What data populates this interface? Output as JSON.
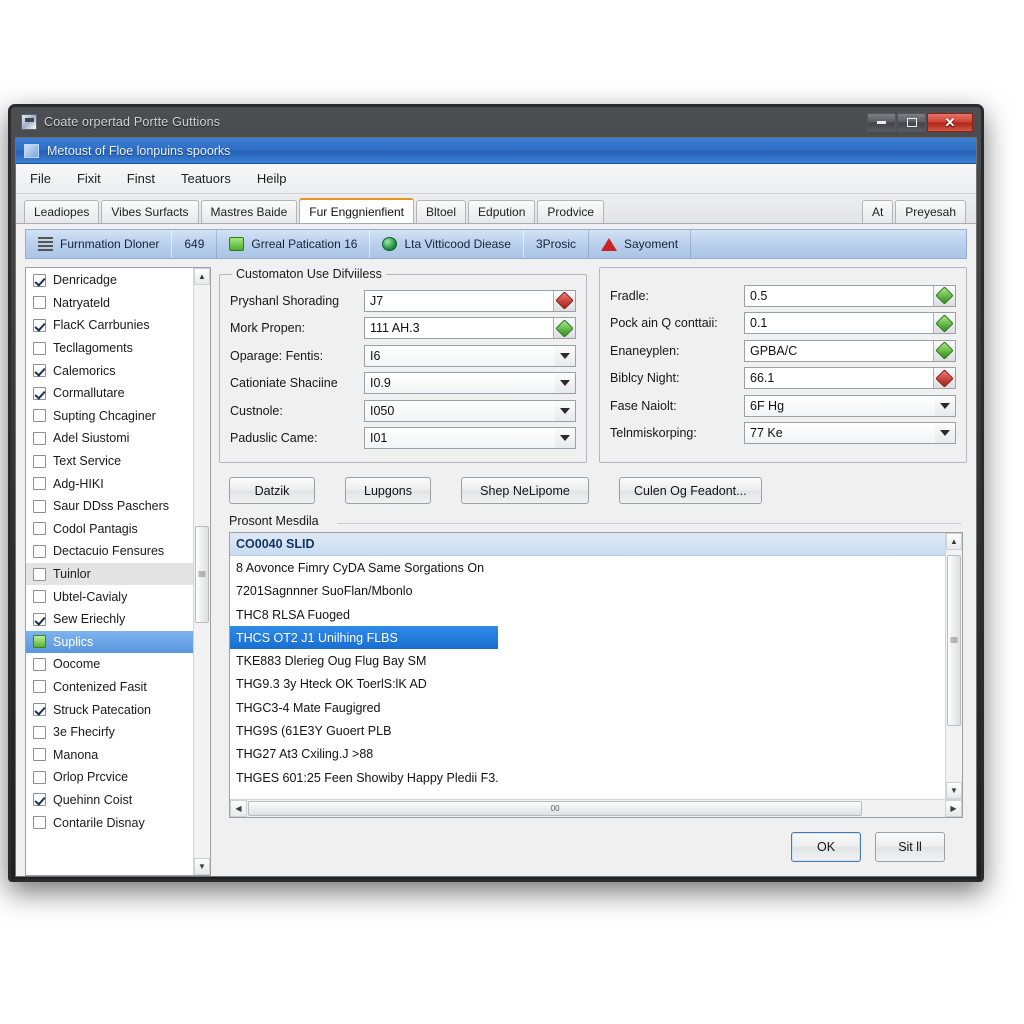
{
  "window": {
    "title": "Coate orpertad Portte Guttions",
    "icon": "app-icon",
    "controls": {
      "minimize": "minimize",
      "maximize": "maximize",
      "close": "close"
    }
  },
  "subheader": {
    "text": "Metoust of Floe lonpuins spoorks",
    "icon": "document-icon"
  },
  "menubar": {
    "items": [
      "File",
      "Fixit",
      "Finst",
      "Teatuors",
      "Heilp"
    ]
  },
  "tabs": {
    "items": [
      {
        "label": "Leadiopes",
        "active": false
      },
      {
        "label": "Vibes Surfacts",
        "active": false
      },
      {
        "label": "Mastres Baide",
        "active": false
      },
      {
        "label": "Fur Enggnienfient",
        "active": true
      },
      {
        "label": "Bltoel",
        "active": false
      },
      {
        "label": "Edpution",
        "active": false
      },
      {
        "label": "Prodvice",
        "active": false
      }
    ],
    "right_items": [
      {
        "label": "At"
      },
      {
        "label": "Preyesah"
      }
    ]
  },
  "toolstrip": {
    "cells": [
      {
        "label": "Furnmation Dloner",
        "icon": "lines-icon"
      },
      {
        "label": "649",
        "icon": "none"
      },
      {
        "label": "Grreal Patication 16",
        "icon": "green-card-icon"
      },
      {
        "label": "Lta Vitticood Diease",
        "icon": "globe-icon"
      },
      {
        "label": "3Prosic",
        "icon": "none"
      },
      {
        "label": "Sayoment",
        "icon": "warning-icon"
      }
    ]
  },
  "checklist": {
    "items": [
      {
        "label": "Denricadge",
        "checked": true,
        "state": "normal"
      },
      {
        "label": "Natryateld",
        "checked": false,
        "state": "normal"
      },
      {
        "label": "FlacK Carrbunies",
        "checked": true,
        "state": "normal"
      },
      {
        "label": "Tecllagoments",
        "checked": false,
        "state": "normal"
      },
      {
        "label": "Calemorics",
        "checked": true,
        "state": "normal"
      },
      {
        "label": "Cormallutare",
        "checked": true,
        "state": "normal"
      },
      {
        "label": "Supting Chcaginer",
        "checked": false,
        "state": "normal"
      },
      {
        "label": "Adel Siustomi",
        "checked": false,
        "state": "normal"
      },
      {
        "label": "Text Service",
        "checked": false,
        "state": "normal"
      },
      {
        "label": "Adg-HIKI",
        "checked": false,
        "state": "normal"
      },
      {
        "label": "Saur DDss Paschers",
        "checked": false,
        "state": "normal"
      },
      {
        "label": "Codol Pantagis",
        "checked": false,
        "state": "normal"
      },
      {
        "label": "Dectacuio Fensures",
        "checked": false,
        "state": "normal"
      },
      {
        "label": "Tuinlor",
        "checked": false,
        "state": "hover"
      },
      {
        "label": "Ubtel-Cavialy",
        "checked": false,
        "state": "normal"
      },
      {
        "label": "Sew Eriechly",
        "checked": true,
        "state": "normal"
      },
      {
        "label": "Suplics",
        "checked": false,
        "state": "selected",
        "icon": "green"
      },
      {
        "label": "Oocome",
        "checked": false,
        "state": "normal"
      },
      {
        "label": "Contenized Fasit",
        "checked": false,
        "state": "normal"
      },
      {
        "label": "Struck Patecation",
        "checked": true,
        "state": "normal"
      },
      {
        "label": "3e Fhecirfy",
        "checked": false,
        "state": "normal"
      },
      {
        "label": "Manona",
        "checked": false,
        "state": "normal"
      },
      {
        "label": "Orlop Prcvice",
        "checked": false,
        "state": "normal"
      },
      {
        "label": "Quehinn Coist",
        "checked": true,
        "state": "normal"
      },
      {
        "label": "Contarile Disnay",
        "checked": false,
        "state": "normal"
      }
    ]
  },
  "group_left": {
    "legend": "Customaton Use Difviiless",
    "fields": [
      {
        "label": "Pryshanl Shorading",
        "value": "J7",
        "control": "spin",
        "gem": "red"
      },
      {
        "label": "Mork Propen:",
        "value": "111 AH.3",
        "control": "spin",
        "gem": "green"
      },
      {
        "label": "Oparage: Fentis:",
        "value": "I6",
        "control": "combo"
      },
      {
        "label": "Cationiate Shaciine",
        "value": "I0.9",
        "control": "combo"
      },
      {
        "label": "Custnole:",
        "value": "I050",
        "control": "combo"
      },
      {
        "label": "Paduslic Came:",
        "value": "I01",
        "control": "combo"
      }
    ]
  },
  "group_right": {
    "legend": "",
    "fields": [
      {
        "label": "Fradle:",
        "value": "0.5",
        "control": "spin",
        "gem": "green"
      },
      {
        "label": "Pock ain Q conttaii:",
        "value": "0.1",
        "control": "spin",
        "gem": "green"
      },
      {
        "label": "Enaneyplen:",
        "value": "GPBA/C",
        "control": "spin",
        "gem": "green"
      },
      {
        "label": "Biblcy Night:",
        "value": "66.1",
        "control": "spin",
        "gem": "red"
      },
      {
        "label": "Fase Naiolt:",
        "value": "6F Hg",
        "control": "combo"
      },
      {
        "label": "Telnmiskorping:",
        "value": "77 Ke",
        "control": "combo"
      }
    ]
  },
  "action_buttons": [
    {
      "label": "Datzik"
    },
    {
      "label": "Lupgons"
    },
    {
      "label": "Shep NeLipome"
    },
    {
      "label": "Culen Og Feadont..."
    }
  ],
  "list_panel": {
    "title": "Prosont Mesdila",
    "header": "CO0040 SLID",
    "rows": [
      {
        "text": "8 Aovonce Fimry CyDA Same Sorgations On",
        "selected": false
      },
      {
        "text": "7201Sagnnner SuoFlan/Mbonlo",
        "selected": false
      },
      {
        "text": "THC8 RLSA Fuoged",
        "selected": false
      },
      {
        "text": "THCS OT2 J1 Unilhing FLBS",
        "selected": true
      },
      {
        "text": "TKE883 Dlerieg Oug Flug Bay SM",
        "selected": false
      },
      {
        "text": "THG9.3 3y Hteck OK ToerlS:lK AD",
        "selected": false
      },
      {
        "text": "THGC3-4 Mate Faugigred",
        "selected": false
      },
      {
        "text": "THG9S (61E3Y Guoert PLB",
        "selected": false
      },
      {
        "text": "THG27 At3 Cxiling.J >88",
        "selected": false
      },
      {
        "text": "THGES 601:25 Feen Showiby Happy Pledii F3.",
        "selected": false
      }
    ],
    "hscroll_value": "00"
  },
  "dialog_buttons": [
    {
      "label": "OK",
      "default": true
    },
    {
      "label": "Sit ll",
      "default": false
    }
  ],
  "colors": {
    "accent_blue": "#2f6ec4",
    "tab_active_top": "#e8921f",
    "selection_blue": "#1a6fd0",
    "close_red": "#cf4436"
  }
}
